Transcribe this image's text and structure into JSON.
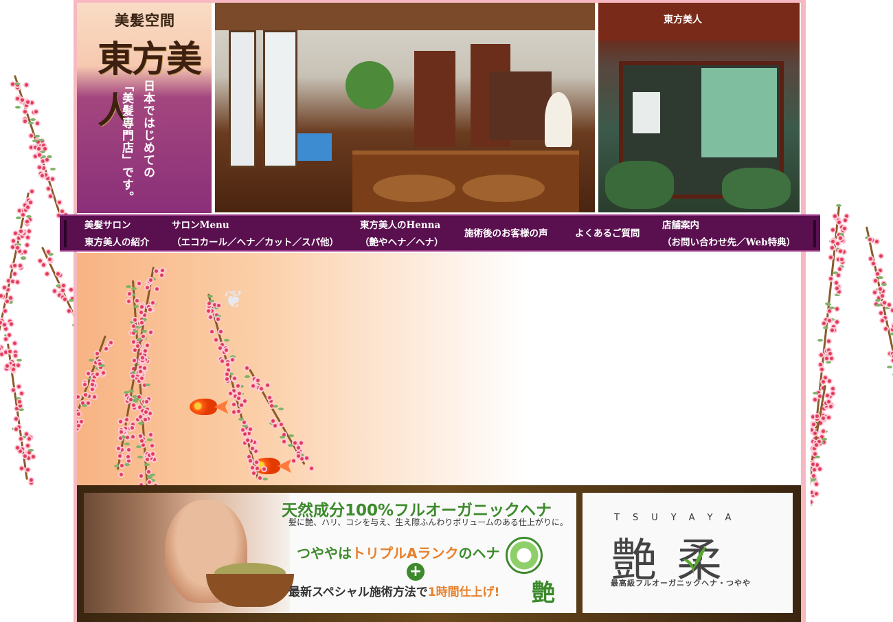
{
  "header": {
    "logo_small": "美髪空間",
    "logo_big": "東方美人",
    "tagline_line1": "日本ではじめての",
    "tagline_line2": "「美髪専門店」です。"
  },
  "nav": {
    "items": [
      {
        "line1": "美髪サロン",
        "line2": "東方美人の紹介"
      },
      {
        "line1": "サロンMenu",
        "line2": "（エコカール／ヘナ／カット／スパ他）"
      },
      {
        "line1": "東方美人のHenna",
        "line2": "（艶やヘナ／ヘナ）"
      },
      {
        "line1": "施術後のお客様の声"
      },
      {
        "line1": "よくあるご質問"
      },
      {
        "line1": "店舗案内",
        "line2": "（お問い合わせ先／Web特典）"
      }
    ]
  },
  "storefront": {
    "sign": "東方美人"
  },
  "ad_left": {
    "title": "天然成分100%フルオーガニックヘナ",
    "subtitle": "髪に艶、ハリ、コシを与え、生え際ふんわりボリュームのある仕上がりに。",
    "rank_pre": "つややは",
    "rank_highlight": "トリプルAランク",
    "rank_post": "のヘナ",
    "plus": "+",
    "method_pre": "最新スペシャル施術方法で",
    "method_highlight": "1時間仕上げ!",
    "mark": "艶"
  },
  "ad_right": {
    "brand_en": "TSUYAYA",
    "brand_kanji": "艶 柔",
    "brand_sub": "最高級フルオーガニックヘナ・つやや"
  },
  "colors": {
    "frame": "#f7b8c2",
    "nav_bg": "#5a0f4f",
    "accent_green": "#3c8a2c",
    "accent_orange": "#e8802a"
  }
}
